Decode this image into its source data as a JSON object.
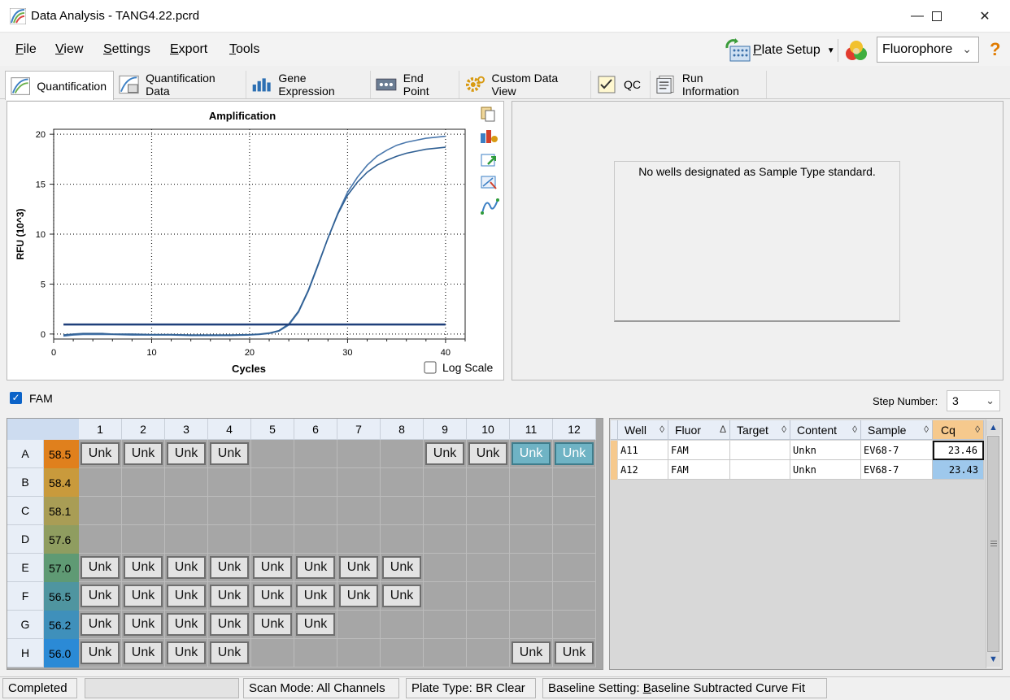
{
  "window": {
    "title": "Data Analysis - TANG4.22.pcrd"
  },
  "menu": {
    "items": [
      {
        "label": "File",
        "u": "F",
        "rest": "ile"
      },
      {
        "label": "View",
        "u": "V",
        "rest": "iew"
      },
      {
        "label": "Settings",
        "u": "S",
        "rest": "ettings"
      },
      {
        "label": "Export",
        "u": "E",
        "rest": "xport"
      },
      {
        "label": "Tools",
        "u": "T",
        "rest": "ools"
      }
    ],
    "plate_setup": {
      "u": "P",
      "rest": "late Setup"
    },
    "fluor_select": "Fluorophore"
  },
  "tabs": [
    "Quantification",
    "Quantification Data",
    "Gene Expression",
    "End Point",
    "Custom Data View",
    "QC",
    "Run Information"
  ],
  "chart_data": {
    "type": "line",
    "title": "Amplification",
    "xlabel": "Cycles",
    "ylabel": "RFU (10^3)",
    "xlim": [
      0,
      42
    ],
    "ylim": [
      -0.5,
      20.5
    ],
    "xticks": [
      0,
      10,
      20,
      30,
      40
    ],
    "yticks": [
      0,
      5,
      10,
      15,
      20
    ],
    "grid": true,
    "threshold": 0.95,
    "log_scale_label": "Log Scale",
    "series": [
      {
        "x": [
          1,
          2,
          3,
          4,
          5,
          6,
          8,
          10,
          12,
          14,
          16,
          18,
          20,
          21,
          22,
          23,
          24,
          25,
          26,
          27,
          28,
          29,
          30,
          31,
          32,
          33,
          34,
          35,
          36,
          37,
          38,
          39,
          40
        ],
        "y": [
          -0.2,
          -0.1,
          -0.05,
          -0.05,
          -0.05,
          -0.05,
          -0.1,
          -0.1,
          -0.1,
          -0.15,
          -0.15,
          -0.15,
          -0.1,
          -0.05,
          0.05,
          0.3,
          0.9,
          2.2,
          4.3,
          6.9,
          9.6,
          12.1,
          14.2,
          15.7,
          16.9,
          17.8,
          18.4,
          18.9,
          19.2,
          19.4,
          19.6,
          19.7,
          19.8
        ]
      },
      {
        "x": [
          1,
          2,
          3,
          4,
          5,
          6,
          8,
          10,
          12,
          14,
          16,
          18,
          20,
          21,
          22,
          23,
          24,
          25,
          26,
          27,
          28,
          29,
          30,
          31,
          32,
          33,
          34,
          35,
          36,
          37,
          38,
          39,
          40
        ],
        "y": [
          -0.1,
          0.0,
          0.05,
          0.05,
          0.05,
          0.0,
          0.0,
          -0.05,
          -0.05,
          -0.1,
          -0.1,
          -0.1,
          -0.05,
          0.0,
          0.1,
          0.35,
          1.0,
          2.3,
          4.4,
          7.0,
          9.6,
          12.0,
          13.9,
          15.2,
          16.2,
          16.9,
          17.4,
          17.8,
          18.1,
          18.3,
          18.5,
          18.6,
          18.7
        ]
      }
    ]
  },
  "standards": {
    "message": "No wells designated as Sample Type standard."
  },
  "fam": {
    "label": "FAM",
    "checked": true
  },
  "step": {
    "label": "Step Number:",
    "value": "3"
  },
  "plate": {
    "columns": [
      "1",
      "2",
      "3",
      "4",
      "5",
      "6",
      "7",
      "8",
      "9",
      "10",
      "11",
      "12"
    ],
    "rows": [
      {
        "id": "A",
        "temp": "58.5",
        "color": "#e0801d",
        "wells": [
          "Unk",
          "Unk",
          "Unk",
          "Unk",
          "",
          "",
          "",
          "",
          "Unk",
          "Unk",
          "Unk*",
          "Unk*"
        ]
      },
      {
        "id": "B",
        "temp": "58.4",
        "color": "#c99a3c",
        "wells": [
          "",
          "",
          "",
          "",
          "",
          "",
          "",
          "",
          "",
          "",
          "",
          ""
        ]
      },
      {
        "id": "C",
        "temp": "58.1",
        "color": "#a99d55",
        "wells": [
          "",
          "",
          "",
          "",
          "",
          "",
          "",
          "",
          "",
          "",
          "",
          ""
        ]
      },
      {
        "id": "D",
        "temp": "57.6",
        "color": "#8f9d60",
        "wells": [
          "",
          "",
          "",
          "",
          "",
          "",
          "",
          "",
          "",
          "",
          "",
          ""
        ]
      },
      {
        "id": "E",
        "temp": "57.0",
        "color": "#5f9a74",
        "wells": [
          "Unk",
          "Unk",
          "Unk",
          "Unk",
          "Unk",
          "Unk",
          "Unk",
          "Unk",
          "",
          "",
          "",
          ""
        ]
      },
      {
        "id": "F",
        "temp": "56.5",
        "color": "#4f95a0",
        "wells": [
          "Unk",
          "Unk",
          "Unk",
          "Unk",
          "Unk",
          "Unk",
          "Unk",
          "Unk",
          "",
          "",
          "",
          ""
        ]
      },
      {
        "id": "G",
        "temp": "56.2",
        "color": "#3f90bb",
        "wells": [
          "Unk",
          "Unk",
          "Unk",
          "Unk",
          "Unk",
          "Unk",
          "",
          "",
          "",
          "",
          "",
          ""
        ]
      },
      {
        "id": "H",
        "temp": "56.0",
        "color": "#2b8ad6",
        "wells": [
          "Unk",
          "Unk",
          "Unk",
          "Unk",
          "",
          "",
          "",
          "",
          "",
          "",
          "Unk",
          "Unk"
        ]
      }
    ]
  },
  "results": {
    "headers": [
      "Well",
      "Fluor",
      "Target",
      "Content",
      "Sample",
      "Cq"
    ],
    "sort_glyphs": [
      "◊",
      "Δ",
      "◊",
      "◊",
      "◊",
      "◊"
    ],
    "rows": [
      [
        "A11",
        "FAM",
        "",
        "Unkn",
        "EV68-7",
        "23.46"
      ],
      [
        "A12",
        "FAM",
        "",
        "Unkn",
        "EV68-7",
        "23.43"
      ]
    ]
  },
  "status": {
    "state": "Completed",
    "scan_mode": "Scan Mode: All Channels",
    "plate_type": "Plate Type: BR Clear",
    "baseline_prefix": "Baseline Setting: ",
    "baseline_u": "B",
    "baseline_rest": "aseline Subtracted Curve Fit"
  }
}
